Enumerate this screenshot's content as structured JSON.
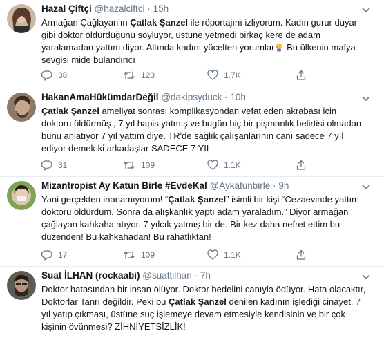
{
  "tweets": [
    {
      "name": "Hazal Çiftçi",
      "handle": "@hazalciftci",
      "separator": "·",
      "time": "15h",
      "segments": [
        {
          "t": "Armağan Çağlayan'ın ",
          "b": false
        },
        {
          "t": "Çatlak Şanzel",
          "b": true
        },
        {
          "t": " ile röportajını izliyorum. Kadın gurur duyar gibi doktor öldürdüğünü söylüyor, üstüne yetmedi birkaç kere de adam yaralamadan yattım diyor. Altında kadını yücelten yorumlar",
          "b": false
        },
        {
          "t": "facepalm-emoji",
          "emoji": true
        },
        {
          "t": " Bu ülkenin mafya sevgisi mide bulandırıcı",
          "b": false
        }
      ],
      "replies": "38",
      "retweets": "123",
      "likes": "1.7K",
      "avatar_color": "#7a5a48"
    },
    {
      "name": "HakanAmaHükümdarDeğil",
      "handle": "@dakipsyduck",
      "separator": "·",
      "time": "10h",
      "segments": [
        {
          "t": "Çatlak Şanzel",
          "b": true
        },
        {
          "t": " ameliyat sonrası komplikasyondan vefat eden akrabası icin doktoru öldürmüş , 7 yıl hapis yatmış ve bugün hiç bir pişmanlık belirtisi olmadan bunu anlatıyor 7 yıl yattım diye. TR'de sağlık çalışanlarının canı sadece 7 yıl ediyor demek ki arkadaşlar SADECE 7 YIL",
          "b": false
        }
      ],
      "replies": "31",
      "retweets": "109",
      "likes": "1.1K",
      "avatar_color": "#5b4a3d"
    },
    {
      "name": "Mizantropist Ay Katun Birle #EvdeKal",
      "handle": "@Aykatunbirle",
      "separator": "·",
      "time": "9h",
      "segments": [
        {
          "t": "Yani gerçekten inanamıyorum! “",
          "b": false
        },
        {
          "t": "Çatlak Şanzel",
          "b": true
        },
        {
          "t": "” isimli bir kişi “Cezaevinde yattım doktoru öldürdüm. Sonra da alışkanlık yaptı adam yaraladım.” Diyor armağan çağlayan kahkaha atıyor. 7 yılcık yatmış bir de. Bir kez daha nefret ettim bu düzenden! Bu kahkahadan! Bu rahatlıktan!",
          "b": false
        }
      ],
      "replies": "17",
      "retweets": "109",
      "likes": "1.1K",
      "avatar_color": "#6f8a4c"
    },
    {
      "name": "Suat İLHAN (rockaabi)",
      "handle": "@suattilhan",
      "separator": "·",
      "time": "7h",
      "segments": [
        {
          "t": "Doktor hatasından bir insan ölüyor. Doktor bedelini canıyla ödüyor. Hata olacaktır, Doktorlar Tanrı değildir. Peki bu ",
          "b": false
        },
        {
          "t": "Çatlak Şanzel",
          "b": true
        },
        {
          "t": " denilen kadının işlediği cinayet, 7 yıl yatıp çıkması, üstüne suç işlemeye devam etmesiyle kendisinin ve bir çok kişinin övünmesi? ZİHNİYETSİZLİK!",
          "b": false
        }
      ],
      "avatar_color": "#3d3a36"
    }
  ]
}
